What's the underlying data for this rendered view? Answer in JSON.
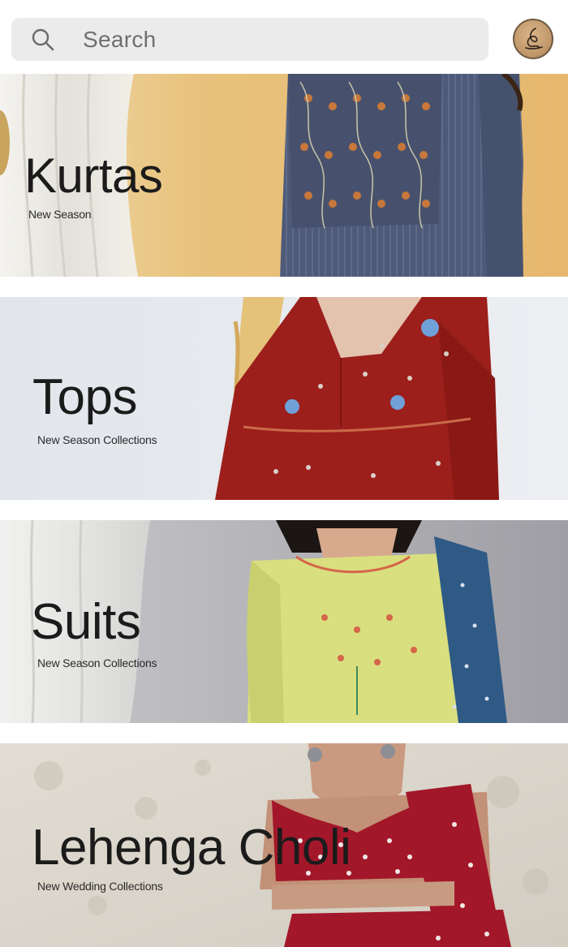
{
  "search": {
    "placeholder": "Search",
    "icon": "search-icon"
  },
  "avatar": {
    "icon": "signature-logo-icon"
  },
  "categories": [
    {
      "title": "Kurtas",
      "subtitle": "New Season",
      "bg": "#e9c688",
      "garment": "#4e5a78"
    },
    {
      "title": "Tops",
      "subtitle": "New Season Collections",
      "bg": "#e6e9ee",
      "garment": "#9c1f1c"
    },
    {
      "title": "Suits",
      "subtitle": "New Season Collections",
      "bg": "#b8b8bd",
      "garment": "#d9df7e"
    },
    {
      "title": "Lehenga Choli",
      "subtitle": "New Wedding Collections",
      "bg": "#dbd6cc",
      "garment": "#a3172a"
    }
  ]
}
